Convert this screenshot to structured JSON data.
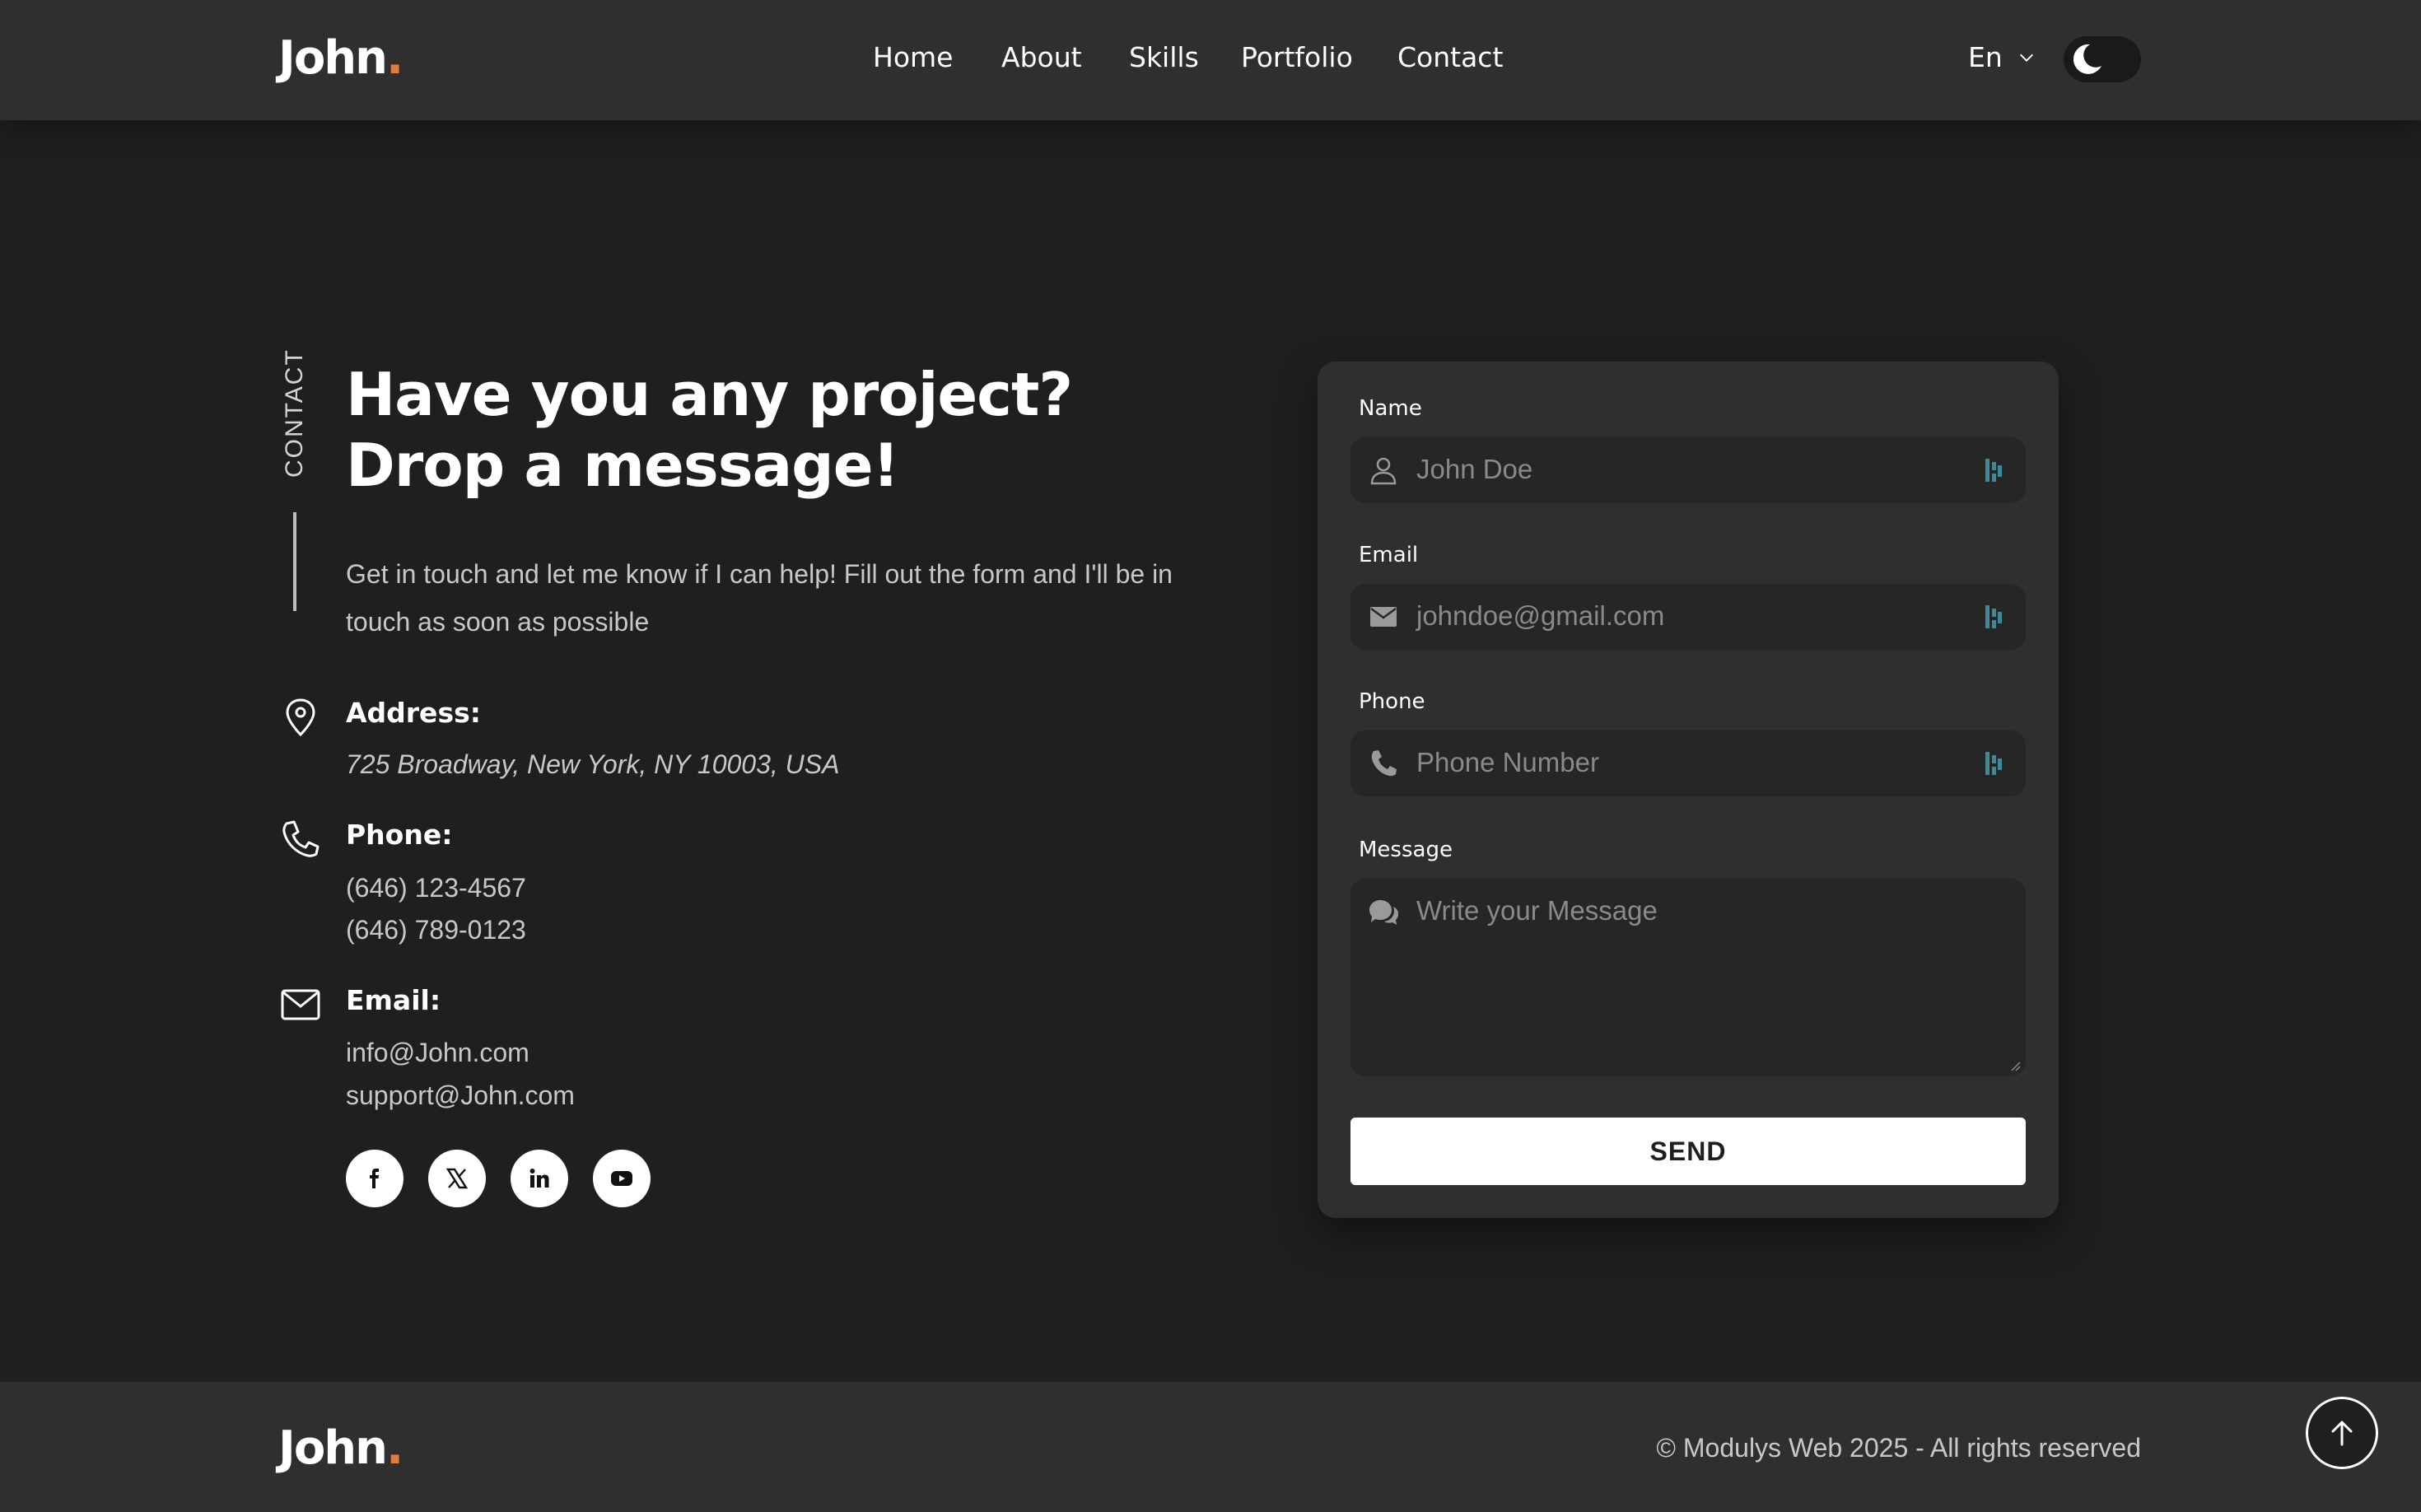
{
  "brand": {
    "name": "John",
    "dot": ".",
    "accent_color": "#e07b3c"
  },
  "nav": {
    "items": [
      {
        "label": "Home"
      },
      {
        "label": "About"
      },
      {
        "label": "Skills"
      },
      {
        "label": "Portfolio"
      },
      {
        "label": "Contact"
      }
    ],
    "language": "En",
    "theme_toggle_icon": "moon-icon"
  },
  "contact": {
    "section_label": "CONTACT",
    "headline_line1": "Have you any project?",
    "headline_line2": "Drop a message!",
    "intro": "Get in touch and let me know if I can help! Fill out the form and I'll be in touch as soon as possible",
    "address": {
      "title": "Address:",
      "value": "725 Broadway, New York, NY 10003, USA",
      "icon": "location-pin-icon"
    },
    "phone": {
      "title": "Phone:",
      "values": [
        "(646) 123-4567",
        "(646) 789-0123"
      ],
      "icon": "phone-icon"
    },
    "email": {
      "title": "Email:",
      "values": [
        "info@John.com",
        "support@John.com"
      ],
      "icon": "envelope-icon"
    },
    "socials": [
      "facebook-icon",
      "x-icon",
      "linkedin-icon",
      "youtube-icon"
    ]
  },
  "form": {
    "name": {
      "label": "Name",
      "placeholder": "John Doe",
      "icon": "user-icon"
    },
    "email": {
      "label": "Email",
      "placeholder": "johndoe@gmail.com",
      "icon": "mail-icon"
    },
    "phone": {
      "label": "Phone",
      "placeholder": "Phone Number",
      "icon": "phone-icon"
    },
    "message": {
      "label": "Message",
      "placeholder": "Write your Message",
      "icon": "chat-icon"
    },
    "submit_label": "SEND"
  },
  "footer": {
    "copyright": "© Modulys Web 2025 - All rights reserved",
    "scroll_top_icon": "arrow-up-icon"
  },
  "colors": {
    "background": "#1f1f1f",
    "header_bg": "#2f2f2f",
    "card_bg": "#2f2f2f",
    "field_bg": "#262626",
    "autofill_icon": "#3b8a9c"
  }
}
